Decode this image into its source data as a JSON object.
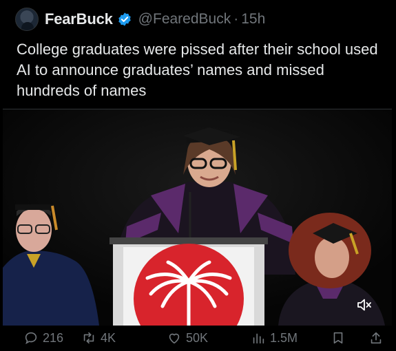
{
  "author": {
    "name": "FearBuck",
    "handle": "@FearedBuck",
    "separator": "·",
    "time": "15h",
    "verified": true
  },
  "tweet": {
    "text": "College graduates were pissed after their school used AI to announce graduates’ names and missed hundreds of names"
  },
  "media": {
    "type": "video",
    "muted": true,
    "icons": {
      "mute": "speaker-muted-icon"
    }
  },
  "actions": {
    "reply_count": "216",
    "retweet_count": "4K",
    "like_count": "50K",
    "views_count": "1.5M"
  },
  "colors": {
    "background": "#000000",
    "text": "#e7e9ea",
    "secondary": "#71767b",
    "verified_blue": "#1d9bf0",
    "podium_red": "#d8242c",
    "gown_purple": "#5b2a6b"
  }
}
